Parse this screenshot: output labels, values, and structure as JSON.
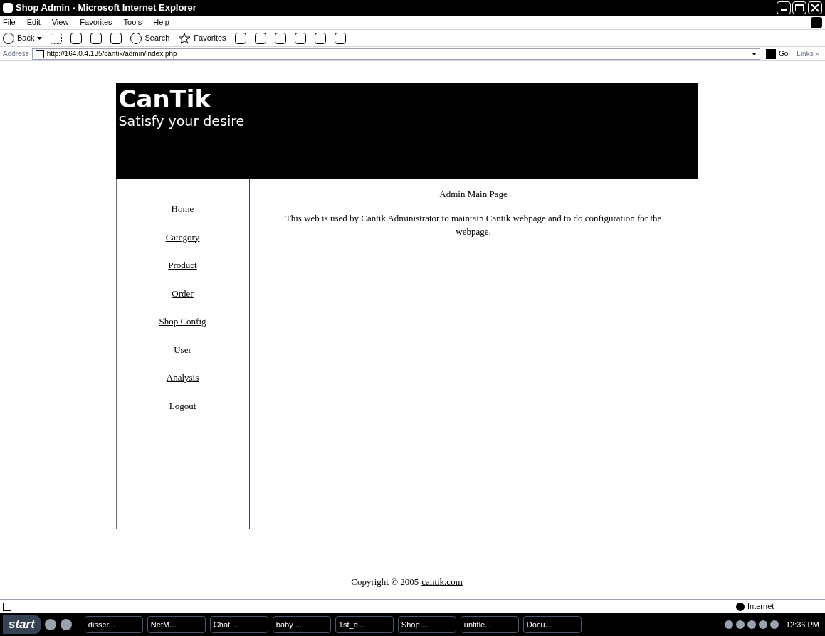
{
  "window": {
    "title": "Shop Admin - Microsoft Internet Explorer"
  },
  "menu": [
    "File",
    "Edit",
    "View",
    "Favorites",
    "Tools",
    "Help"
  ],
  "toolbar": {
    "back": "Back",
    "search": "Search",
    "favorites": "Favorites"
  },
  "address_bar": {
    "label": "Address",
    "value": "http://164.0.4.135/cantik/admin/index.php",
    "go": "Go",
    "links": "Links »"
  },
  "banner": {
    "logo": "CanTik",
    "tagline": "Satisfy your desire"
  },
  "sidebar": {
    "items": [
      {
        "label": "Home"
      },
      {
        "label": "Category"
      },
      {
        "label": "Product"
      },
      {
        "label": "Order"
      },
      {
        "label": "Shop Config"
      },
      {
        "label": "User"
      },
      {
        "label": "Analysis"
      },
      {
        "label": "Logout"
      }
    ]
  },
  "main": {
    "heading": "Admin Main Page",
    "text": "This web is used by Cantik Administrator to maintain Cantik webpage and to do configuration for the webpage."
  },
  "footer": {
    "text": "Copyright © 2005",
    "link": "cantik.com"
  },
  "status_bar": {
    "zone": "Internet"
  },
  "taskbar": {
    "start": "start",
    "items": [
      "disser...",
      "NetM...",
      "Chat ...",
      "baby ...",
      "1st_d...",
      "Shop ...",
      "untitle...",
      "Docu..."
    ],
    "clock": "12:36 PM"
  }
}
